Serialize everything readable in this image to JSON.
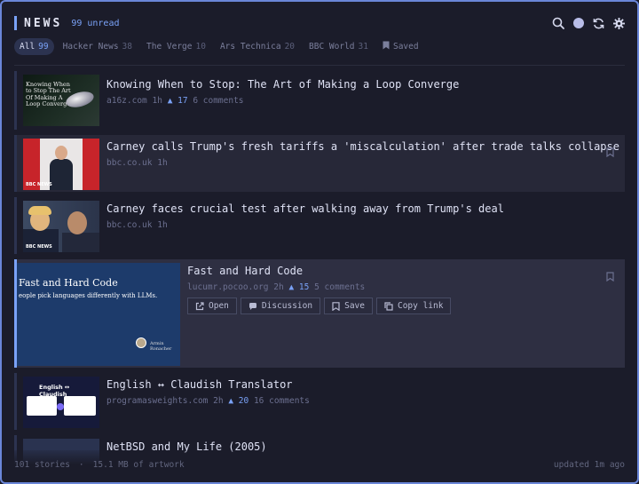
{
  "header": {
    "title": "NEWS",
    "unread": "99 unread"
  },
  "tabs": [
    {
      "label": "All",
      "count": "99",
      "active": true
    },
    {
      "label": "Hacker News",
      "count": "38"
    },
    {
      "label": "The Verge",
      "count": "10"
    },
    {
      "label": "Ars Technica",
      "count": "20"
    },
    {
      "label": "BBC World",
      "count": "31"
    },
    {
      "label": "Saved",
      "count": ""
    }
  ],
  "items": [
    {
      "title": "Knowing When to Stop: The Art of Making a Loop Converge",
      "source": "a16z.com",
      "age": "1h",
      "score": "▲ 17",
      "comments": "6 comments",
      "thumb_text": "Knowing When to Stop The Art Of Making A Loop Converge"
    },
    {
      "title": "Carney calls Trump's fresh tariffs a 'miscalculation' after trade talks collapse",
      "source": "bbc.co.uk",
      "age": "1h",
      "thumb_text": "BBC NEWS"
    },
    {
      "title": "Carney faces crucial test after walking away from Trump's deal",
      "source": "bbc.co.uk",
      "age": "1h",
      "thumb_text": "BBC NEWS"
    },
    {
      "title": "Fast and Hard Code",
      "source": "lucumr.pocoo.org",
      "age": "2h",
      "score": "▲ 15",
      "comments": "5 comments",
      "thumb_title": "Fast and Hard Code",
      "thumb_sub": "eople pick languages differently with LLMs.",
      "thumb_author": "Armin Ronacher",
      "actions": {
        "open": "Open",
        "discussion": "Discussion",
        "save": "Save",
        "copy": "Copy link"
      }
    },
    {
      "title": "English ↔ Claudish Translator",
      "source": "programasweights.com",
      "age": "2h",
      "score": "▲ 20",
      "comments": "16 comments",
      "thumb_text": "English ↔ Claudish"
    },
    {
      "title": "NetBSD and My Life (2005)"
    }
  ],
  "footer": {
    "stories": "101 stories",
    "artwork": "15.1 MB of artwork",
    "updated": "updated 1m ago"
  },
  "colors": {
    "accent": "#7aa2f7",
    "background": "#1b1c2a"
  },
  "icons": [
    "search-icon",
    "theme-dot-icon",
    "refresh-icon",
    "gear-icon",
    "bookmark-icon",
    "external-link-icon",
    "chat-icon",
    "copy-icon"
  ]
}
